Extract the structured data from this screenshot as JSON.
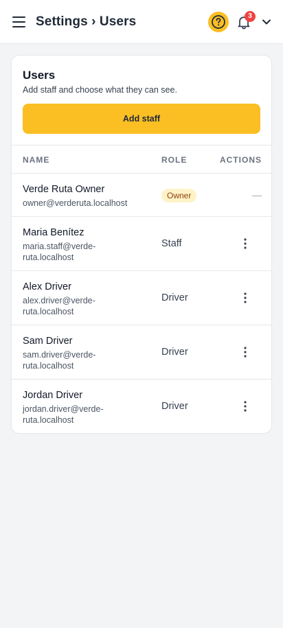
{
  "header": {
    "title": "Settings › Users",
    "help_icon": "question-circle-icon",
    "notification_count": "3",
    "accent": "#fbbf24"
  },
  "card": {
    "title": "Users",
    "subtitle": "Add staff and choose what they can see.",
    "add_button": "Add staff"
  },
  "table": {
    "columns": [
      "NAME",
      "ROLE",
      "ACTIONS"
    ],
    "rows": [
      {
        "name": "Verde Ruta Owner",
        "email": "owner@verderuta.localhost",
        "role": "Owner",
        "action": "—"
      },
      {
        "name": "Maria Benítez",
        "email": "maria.staff@verde-ruta.localhost",
        "role": "Staff"
      },
      {
        "name": "Alex Driver",
        "email": "alex.driver@verde-ruta.localhost",
        "role": "Driver"
      },
      {
        "name": "Sam Driver",
        "email": "sam.driver@verde-ruta.localhost",
        "role": "Driver"
      },
      {
        "name": "Jordan Driver",
        "email": "jordan.driver@verde-ruta.localhost",
        "role": "Driver"
      }
    ]
  }
}
